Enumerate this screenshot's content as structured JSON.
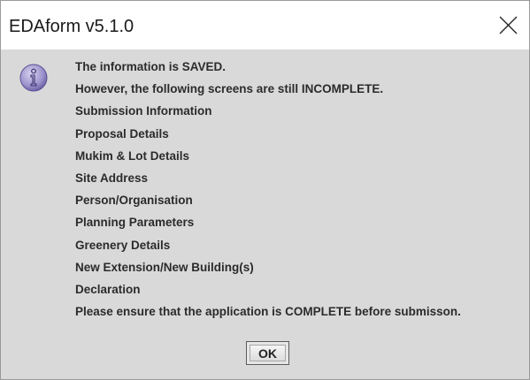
{
  "window": {
    "title": "EDAform v5.1.0",
    "close_icon": "close-icon"
  },
  "dialog": {
    "icon": "info-icon",
    "messages": [
      "The information is SAVED.",
      "However, the following screens are still INCOMPLETE.",
      "Submission Information",
      "Proposal Details",
      "Mukim & Lot Details",
      "Site Address",
      "Person/Organisation",
      "Planning Parameters",
      "Greenery Details",
      "New Extension/New Building(s)",
      "Declaration",
      "Please ensure that the application is COMPLETE before submisson."
    ],
    "ok_label": "OK"
  }
}
